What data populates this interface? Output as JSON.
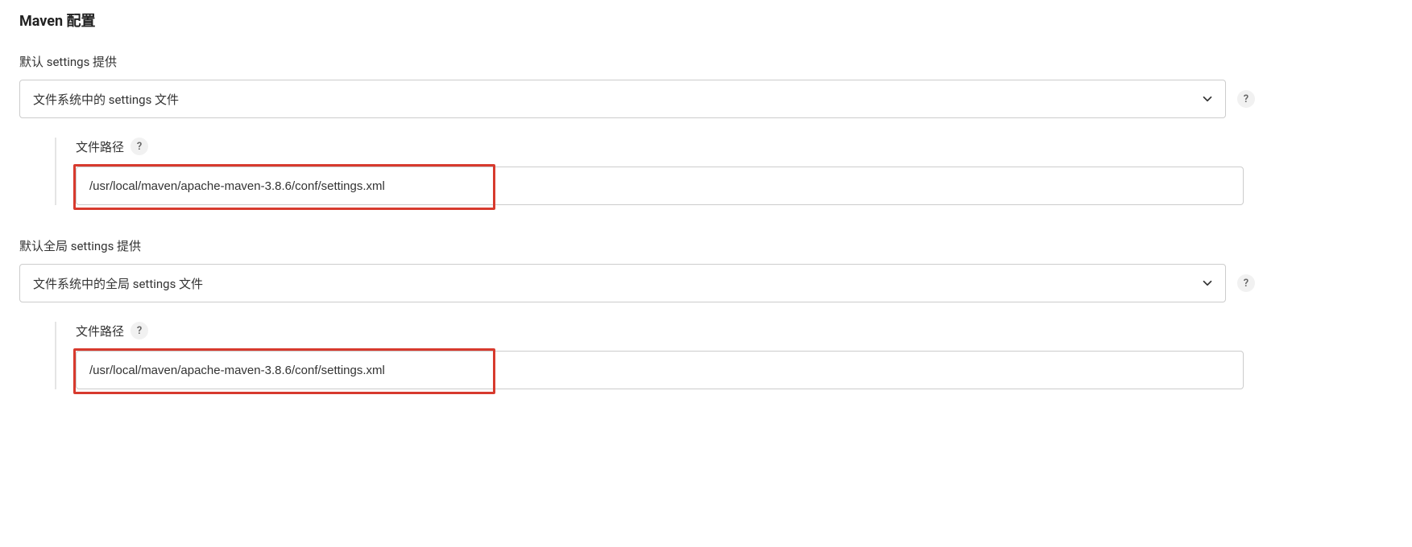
{
  "section_title": "Maven 配置",
  "default_settings": {
    "label": "默认 settings 提供",
    "select_value": "文件系统中的 settings 文件",
    "file_path": {
      "label": "文件路径",
      "value": "/usr/local/maven/apache-maven-3.8.6/conf/settings.xml"
    }
  },
  "global_settings": {
    "label": "默认全局 settings 提供",
    "select_value": "文件系统中的全局 settings 文件",
    "file_path": {
      "label": "文件路径",
      "value": "/usr/local/maven/apache-maven-3.8.6/conf/settings.xml"
    }
  },
  "help_glyph": "?"
}
